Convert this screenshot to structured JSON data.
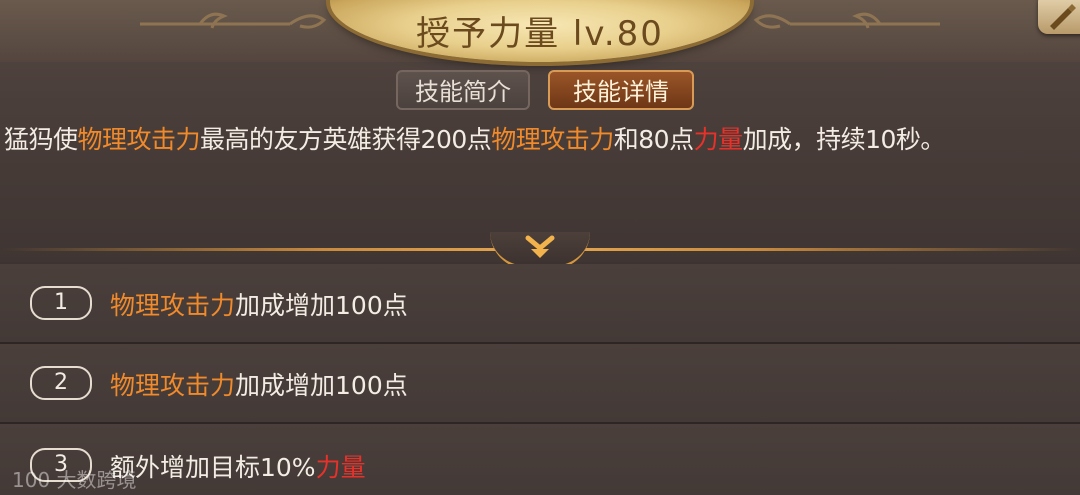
{
  "title": {
    "skill_name": "授予力量",
    "level": "lv.80"
  },
  "tabs": {
    "intro_label": "技能简介",
    "details_label": "技能详情"
  },
  "description": {
    "p1": "猛犸使",
    "h1": "物理攻击力",
    "p2": "最高的友方英雄获得200点",
    "h2": "物理攻击力",
    "p3": "和80点",
    "h3": "力量",
    "p4": "加成，持续10秒。"
  },
  "upgrades": [
    {
      "number": "1",
      "highlight": "物理攻击力",
      "text": "加成增加100点"
    },
    {
      "number": "2",
      "highlight": "物理攻击力",
      "text": "加成增加100点"
    },
    {
      "number": "3",
      "text": "额外增加目标10%",
      "highlight": "力量"
    }
  ],
  "watermark": "100 大数跨境",
  "colors": {
    "highlight_orange": "#f08a2a",
    "highlight_red": "#e8312a",
    "accent_gold": "#d4963f"
  },
  "icons": {
    "edit": "quill-edit-icon",
    "expand": "double-chevron-down-icon"
  }
}
